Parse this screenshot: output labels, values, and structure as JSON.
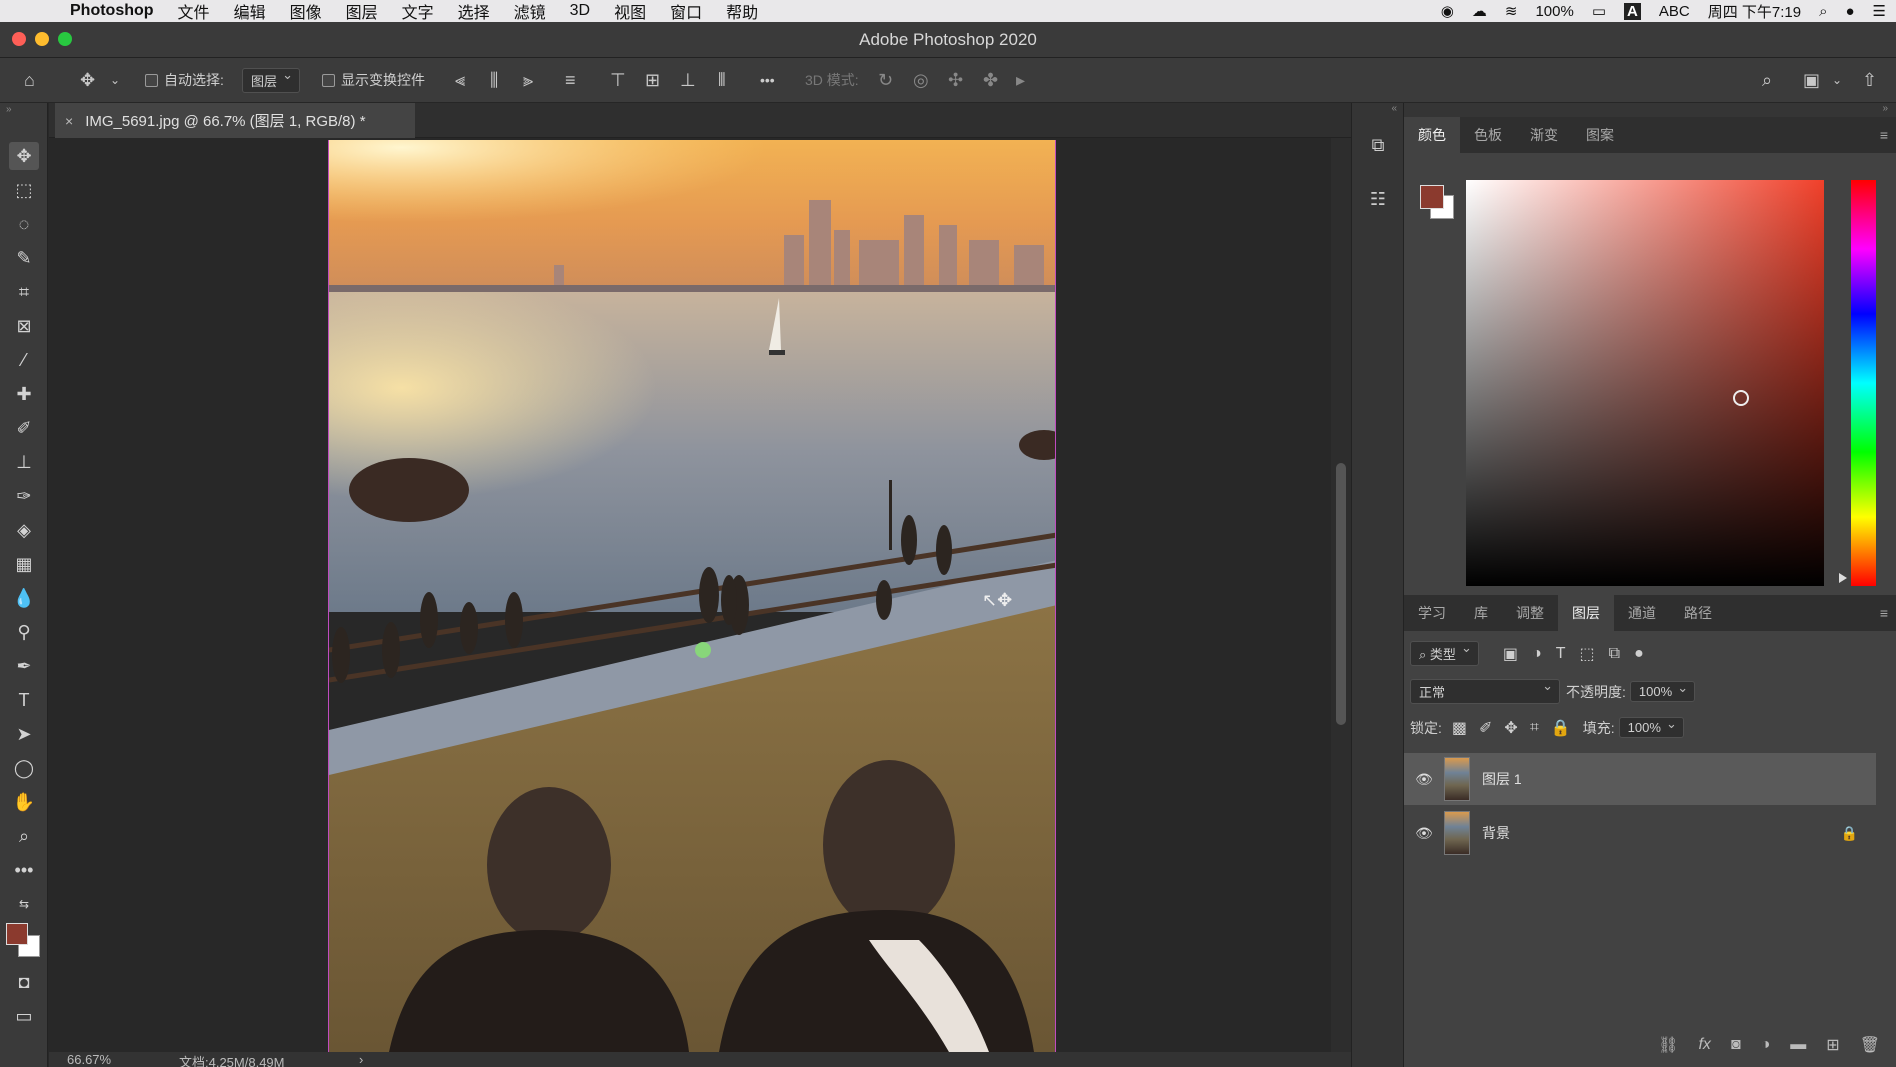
{
  "menubar": {
    "app_name": "Photoshop",
    "items": [
      "文件",
      "编辑",
      "图像",
      "图层",
      "文字",
      "选择",
      "滤镜",
      "3D",
      "视图",
      "窗口",
      "帮助"
    ],
    "battery": "100%",
    "input_source": "ABC",
    "clock": "周四 下午7:19"
  },
  "window": {
    "title": "Adobe Photoshop 2020"
  },
  "options": {
    "auto_select_label": "自动选择:",
    "auto_select_value": "图层",
    "show_transform_label": "显示变换控件",
    "mode_3d_label": "3D 模式:",
    "more_label": "•••"
  },
  "document": {
    "tab_title": "IMG_5691.jpg @ 66.7% (图层 1, RGB/8) *",
    "close_glyph": "×"
  },
  "status": {
    "zoom": "66.67%",
    "doc_size": "文档:4.25M/8.49M"
  },
  "color_panel": {
    "tabs": [
      "颜色",
      "色板",
      "渐变",
      "图案"
    ],
    "foreground": "#8b3a2e",
    "background": "#ffffff"
  },
  "layers_panel": {
    "tabs": [
      "学习",
      "库",
      "调整",
      "图层",
      "通道",
      "路径"
    ],
    "filter_label": "类型",
    "blend_mode": "正常",
    "opacity_label": "不透明度:",
    "opacity_value": "100%",
    "lock_label": "锁定:",
    "fill_label": "填充:",
    "fill_value": "100%",
    "layers": [
      {
        "name": "图层 1",
        "selected": true,
        "locked": false
      },
      {
        "name": "背景",
        "selected": false,
        "locked": true
      }
    ]
  },
  "icons": {
    "toolbar": [
      "move-icon",
      "marquee-icon",
      "lasso-icon",
      "quick-select-icon",
      "crop-icon",
      "frame-icon",
      "eyedropper-icon",
      "healing-brush-icon",
      "brush-icon",
      "clone-stamp-icon",
      "history-brush-icon",
      "eraser-icon",
      "gradient-icon",
      "blur-icon",
      "dodge-icon",
      "pen-icon",
      "type-icon",
      "path-select-icon",
      "ellipse-icon",
      "hand-icon",
      "zoom-icon",
      "more-tools-icon"
    ]
  },
  "colors": {
    "accent_selection": "#5a5a5a",
    "canvas_border": "#c04bc0"
  }
}
